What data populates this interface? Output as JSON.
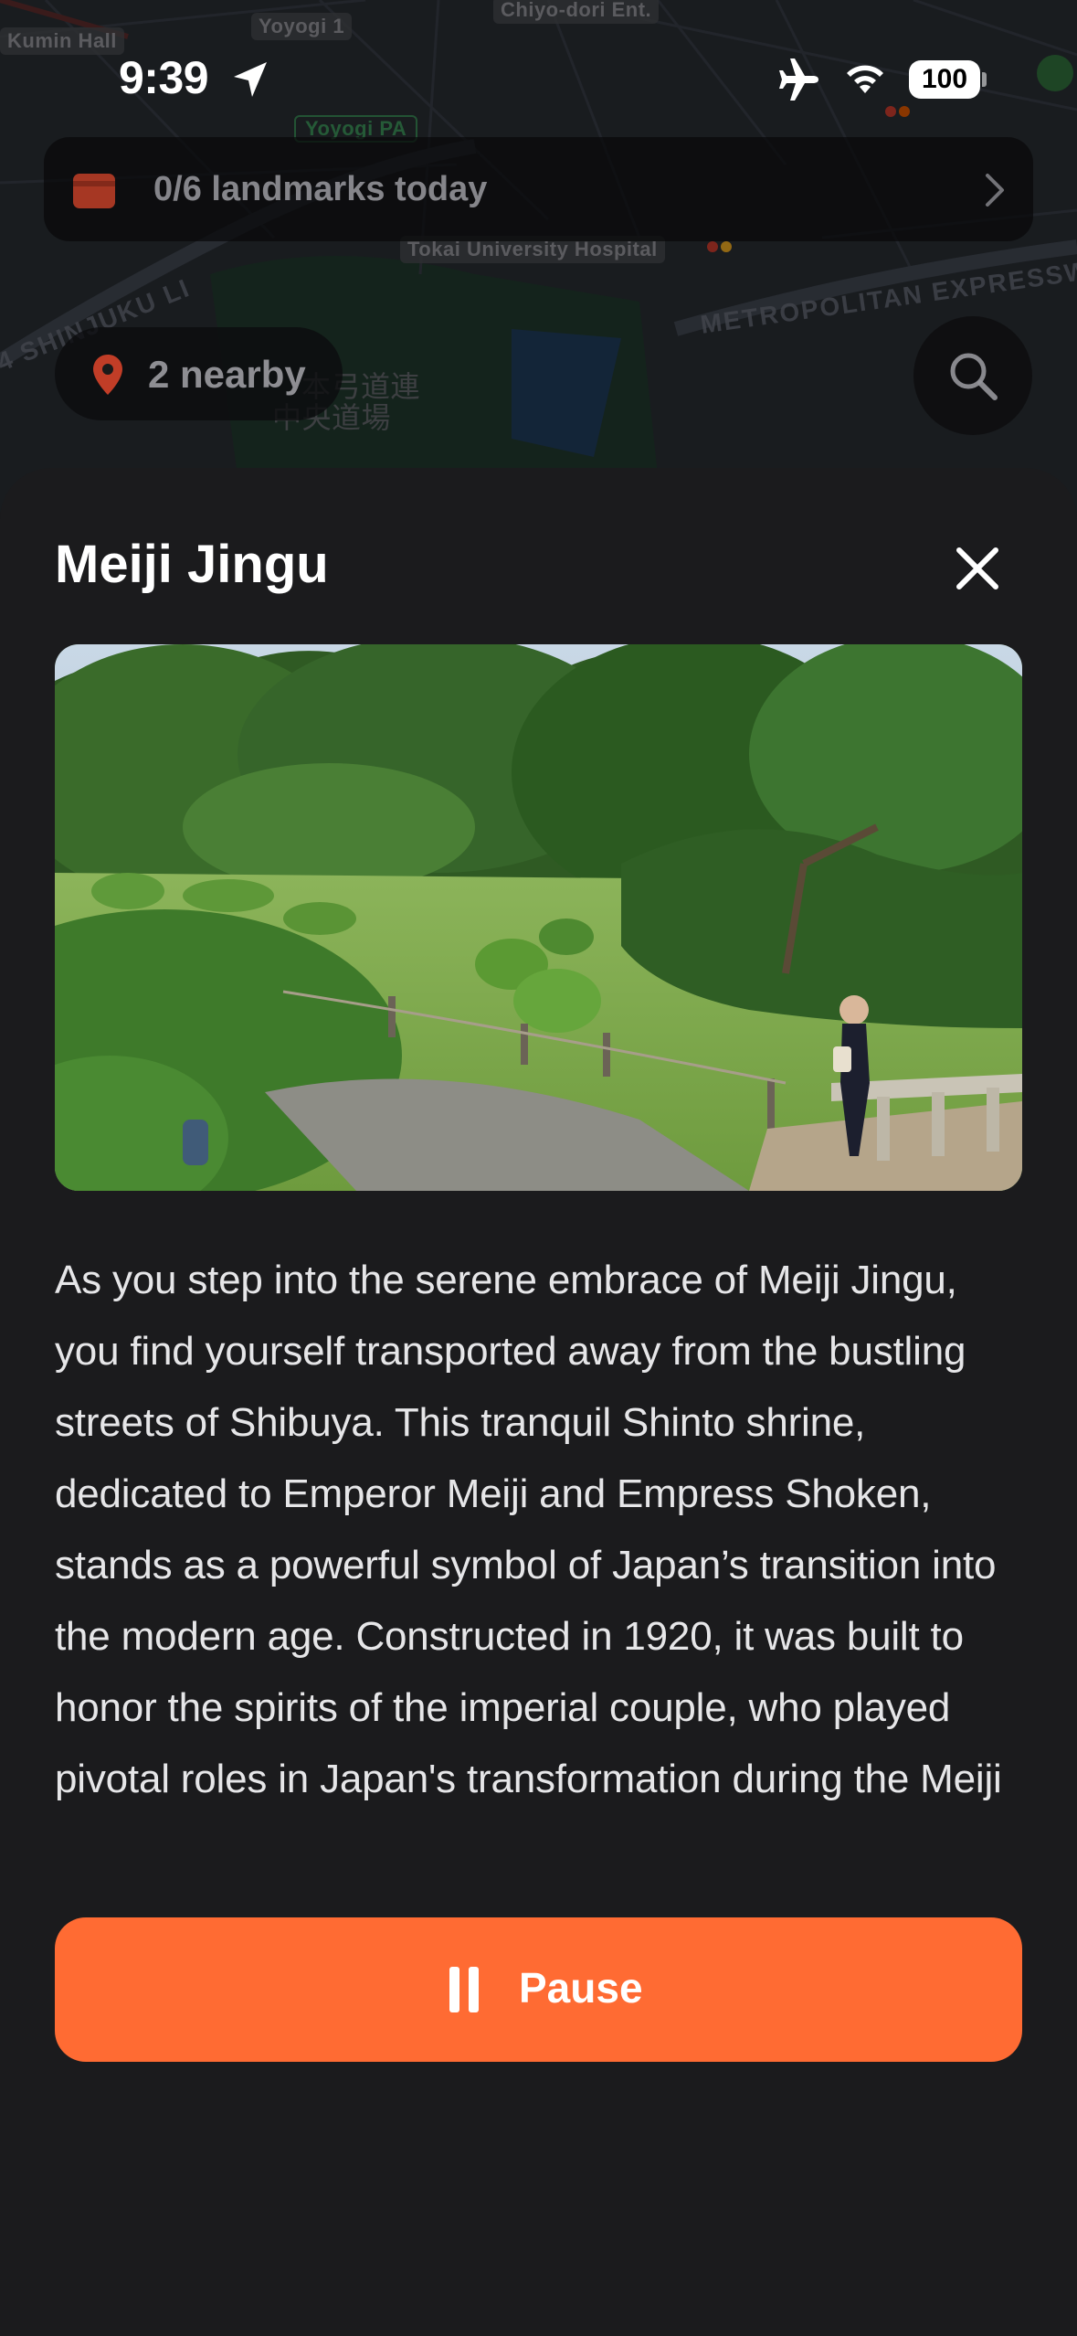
{
  "status_bar": {
    "time": "9:39",
    "battery": "100",
    "icons": [
      "location-arrow-icon",
      "airplane-icon",
      "wifi-icon",
      "battery-icon"
    ]
  },
  "map": {
    "labels": {
      "kumin_hall": "Kumin Hall",
      "yoyogi1": "Yoyogi 1",
      "chiyo_dori": "Chiyo-dori Ent.",
      "yoyogi_pa": "Yoyogi PA",
      "tokai_hospital": "Tokai University Hospital",
      "metropolitan_expressway": "METROPOLITAN EXPRESSW",
      "shinjuku_line": "SHINJUKU LI",
      "route4": "4 SHINJUKU LI",
      "kyudo1": "本弓道連",
      "kyudo2": "中央道場"
    }
  },
  "landmark_bar": {
    "label": "0/6 landmarks today",
    "icon": "ticket-icon",
    "chevron": "chevron-right-icon"
  },
  "nearby": {
    "label": "2 nearby",
    "icon": "map-pin-icon"
  },
  "search": {
    "icon": "search-icon"
  },
  "sheet": {
    "title": "Meiji Jingu",
    "close_icon": "close-icon",
    "photo_alt": "Meiji Jingu garden",
    "description": "As you step into the serene embrace of Meiji Jingu, you find yourself transported away from the bustling streets of Shibuya. This tranquil Shinto shrine, dedicated to Emperor Meiji and Empress Shoken, stands as a powerful symbol of Japan’s transition into the modern age. Constructed in 1920, it was built to honor the spirits of the imperial couple, who played pivotal roles in Japan's transformation during the Meiji",
    "pause_label": "Pause",
    "pause_icon": "pause-icon"
  },
  "colors": {
    "accent": "#ff6b33",
    "sheet_bg": "#1b1b1d",
    "pin_red": "#e0452c",
    "ticket_red": "#d9452b"
  }
}
